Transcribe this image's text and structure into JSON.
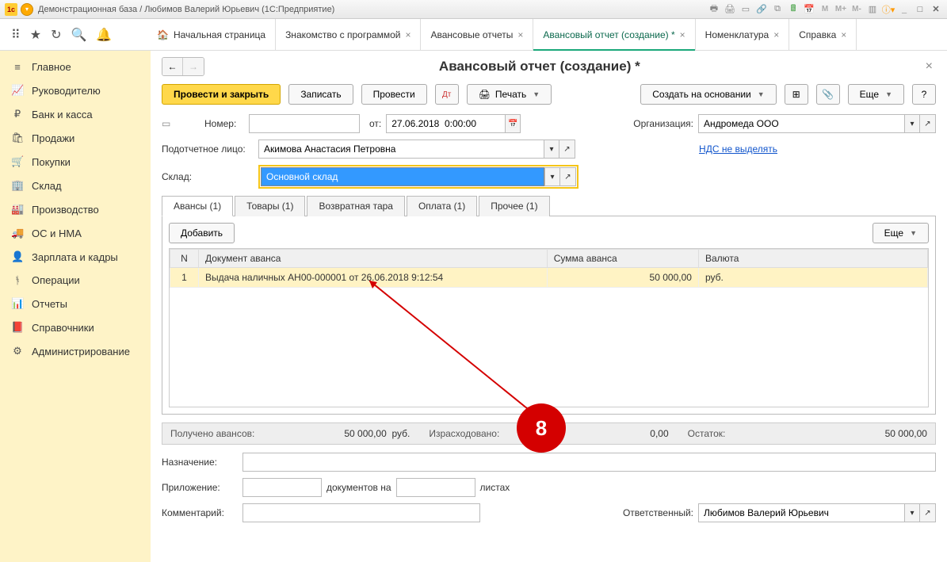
{
  "window_title": "Демонстрационная база / Любимов Валерий Юрьевич  (1С:Предприятие)",
  "top_tabs": {
    "home": "Начальная страница",
    "t1": "Знакомство с программой",
    "t2": "Авансовые отчеты",
    "t3": "Авансовый отчет (создание) *",
    "t4": "Номенклатура",
    "t5": "Справка"
  },
  "sidebar": [
    {
      "icon": "≡",
      "label": "Главное"
    },
    {
      "icon": "📈",
      "label": "Руководителю"
    },
    {
      "icon": "₽",
      "label": "Банк и касса"
    },
    {
      "icon": "🛍",
      "label": "Продажи"
    },
    {
      "icon": "🛒",
      "label": "Покупки"
    },
    {
      "icon": "🏢",
      "label": "Склад"
    },
    {
      "icon": "🏭",
      "label": "Производство"
    },
    {
      "icon": "🚚",
      "label": "ОС и НМА"
    },
    {
      "icon": "👤",
      "label": "Зарплата и кадры"
    },
    {
      "icon": "ᚬ",
      "label": "Операции"
    },
    {
      "icon": "📊",
      "label": "Отчеты"
    },
    {
      "icon": "📕",
      "label": "Справочники"
    },
    {
      "icon": "⚙",
      "label": "Администрирование"
    }
  ],
  "page_title": "Авансовый отчет (создание) *",
  "toolbar": {
    "post_close": "Провести и закрыть",
    "save": "Записать",
    "post": "Провести",
    "print": "Печать",
    "create_based": "Создать на основании",
    "more": "Еще"
  },
  "form": {
    "number_lbl": "Номер:",
    "number_val": "",
    "from_lbl": "от:",
    "date_val": "27.06.2018  0:00:00",
    "org_lbl": "Организация:",
    "org_val": "Андромеда ООО",
    "person_lbl": "Подотчетное лицо:",
    "person_val": "Акимова Анастасия Петровна",
    "vat_link": "НДС не выделять",
    "sklad_lbl": "Склад:",
    "sklad_val": "Основной склад"
  },
  "doctabs": {
    "t0": "Авансы (1)",
    "t1": "Товары (1)",
    "t2": "Возвратная тара",
    "t3": "Оплата (1)",
    "t4": "Прочее (1)"
  },
  "add_btn": "Добавить",
  "more_btn": "Еще",
  "grid": {
    "h_n": "N",
    "h_doc": "Документ аванса",
    "h_sum": "Сумма аванса",
    "h_cur": "Валюта",
    "rows": [
      {
        "n": "1",
        "doc": "Выдача наличных АН00-000001 от 26.06.2018 9:12:54",
        "sum": "50 000,00",
        "cur": "руб."
      }
    ]
  },
  "totals": {
    "got_lbl": "Получено авансов:",
    "got_val": "50 000,00",
    "got_cur": "руб.",
    "spent_lbl": "Израсходовано:",
    "spent_val": "0,00",
    "rest_lbl": "Остаток:",
    "rest_val": "50 000,00"
  },
  "bottom": {
    "nazn_lbl": "Назначение:",
    "pril_lbl": "Приложение:",
    "docs_on": "документов на",
    "sheets": "листах",
    "comm_lbl": "Комментарий:",
    "resp_lbl": "Ответственный:",
    "resp_val": "Любимов Валерий Юрьевич"
  },
  "annotation": "8"
}
